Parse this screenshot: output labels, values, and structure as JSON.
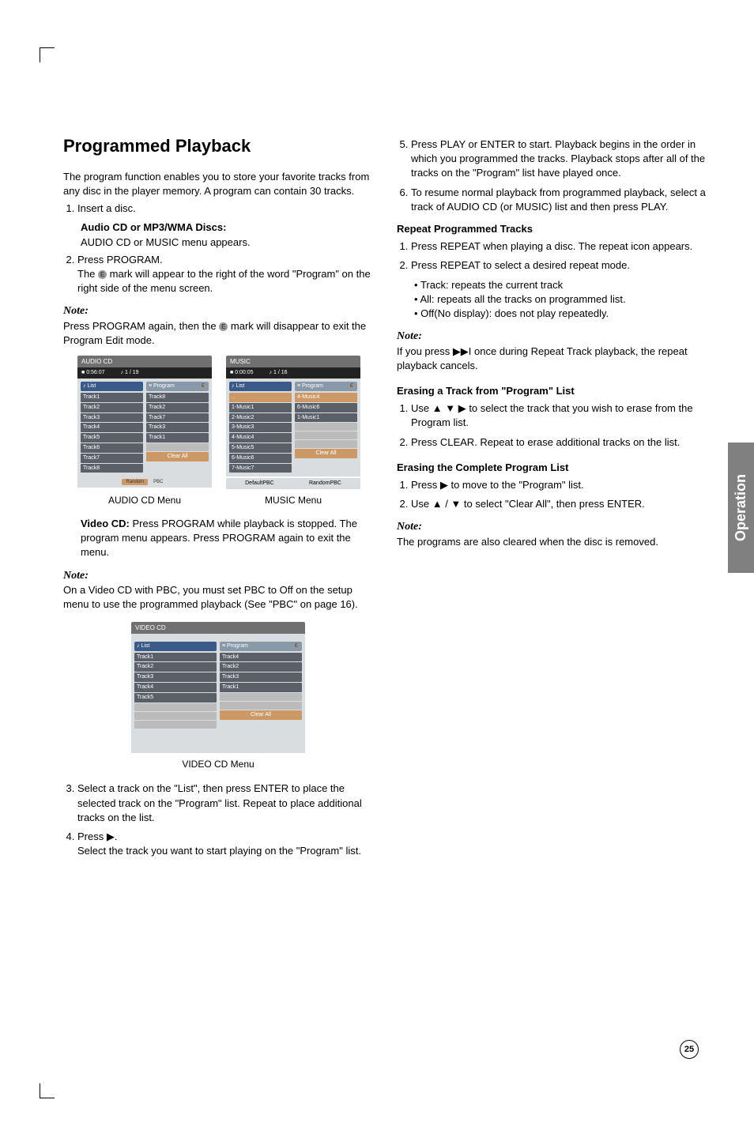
{
  "sideTab": "Operation",
  "pageNumber": "25",
  "heading": "Programmed Playback",
  "intro": "The program function enables you to store your favorite tracks from any disc in the player memory. A program can contain 30 tracks.",
  "step1": "Insert a disc.",
  "audioHeader": "Audio CD or MP3/WMA Discs:",
  "audioLine": "AUDIO CD or MUSIC menu appears.",
  "step2": "Press PROGRAM.",
  "step2_detail_a": "The ",
  "e_icon": "E",
  "step2_detail_b": " mark will appear to the right of the word \"Program\" on the right side of the menu screen.",
  "noteLabel": "Note:",
  "note1_a": "Press PROGRAM again, then the ",
  "note1_b": " mark will disappear to exit the Program Edit mode.",
  "menuAudio": {
    "title": "AUDIO CD",
    "status_a": "0:56:07",
    "status_b": "1 / 19",
    "listHead": "List",
    "progHead": "Program",
    "list": [
      "Track1",
      "Track2",
      "Track3",
      "Track4",
      "Track5",
      "Track6",
      "Track7",
      "Track8"
    ],
    "prog": [
      "Track8",
      "Track2",
      "Track7",
      "Track3",
      "Track1"
    ],
    "clear": "Clear All",
    "foot1": "Random",
    "foot2": "PBC"
  },
  "menuMusic": {
    "title": "MUSIC",
    "status_a": "0:00:05",
    "status_b": "1 / 16",
    "listHead": "List",
    "progHead": "Program",
    "list": [
      "1-Music1",
      "2-Music2",
      "3-Music3",
      "4-Music4",
      "5-Music5",
      "6-Music6",
      "7-Music7"
    ],
    "listFirst": "..",
    "prog": [
      "4-Music4",
      "6-Music6",
      "1-Music1"
    ],
    "clear": "Clear All",
    "foot1a": "Default",
    "foot1b": "PBC",
    "foot2a": "Random",
    "foot2b": "PBC"
  },
  "cap_audio": "AUDIO CD Menu",
  "cap_music": "MUSIC Menu",
  "videoCD_label": "Video CD:",
  "videoCD_text": " Press PROGRAM while playback is stopped. The program menu appears. Press PROGRAM again to exit the menu.",
  "note2": "On a Video CD with PBC, you must set PBC to Off on the setup menu to use the programmed playback (See \"PBC\" on page 16).",
  "menuVideo": {
    "title": "VIDEO CD",
    "listHead": "List",
    "progHead": "Program",
    "list": [
      "Track1",
      "Track2",
      "Track3",
      "Track4",
      "Track5"
    ],
    "prog": [
      "Track4",
      "Track2",
      "Track3",
      "Track1"
    ],
    "clear": "Clear All"
  },
  "cap_video": "VIDEO CD Menu",
  "step3": "Select a track on the \"List\", then press ENTER to place the selected track on the \"Program\" list. Repeat to place additional tracks on the list.",
  "step4_a": "Press ",
  "arrow_right": "▶",
  "step4_b": ".",
  "step4_c": "Select the track you want to start playing on the \"Program\" list.",
  "step5": "Press PLAY or ENTER to start. Playback begins in the order in which you programmed the tracks. Playback stops after all of the tracks on the \"Program\" list have played once.",
  "step6": "To resume normal playback from programmed playback, select a track of AUDIO CD (or MUSIC) list and then press PLAY.",
  "repeatHeader": "Repeat Programmed Tracks",
  "repeat1": "Press REPEAT when playing a disc. The repeat icon appears.",
  "repeat2": "Press REPEAT to select a desired repeat mode.",
  "repeat_b1": "Track: repeats the current track",
  "repeat_b2": "All: repeats all the tracks on programmed list.",
  "repeat_b3": "Off(No display): does not play repeatedly.",
  "note3_a": "If you press ",
  "skip_icon": "▶▶I",
  "note3_b": " once during Repeat Track playback, the repeat playback cancels.",
  "eraseTrackHeader": "Erasing a Track from \"Program\" List",
  "erase1_a": "Use ",
  "arrows_udr": "▲ ▼ ▶",
  "erase1_b": " to select the track that you wish to erase from the Program list.",
  "erase2": "Press CLEAR. Repeat to erase additional tracks on the list.",
  "eraseAllHeader": "Erasing the Complete Program List",
  "eraseAll1_a": "Press ",
  "eraseAll1_b": " to move to the \"Program\" list.",
  "eraseAll2_a": "Use ",
  "arrows_ud": "▲ / ▼",
  "eraseAll2_b": " to select \"Clear All\", then press ENTER.",
  "note4": "The programs are also cleared when the disc is removed."
}
